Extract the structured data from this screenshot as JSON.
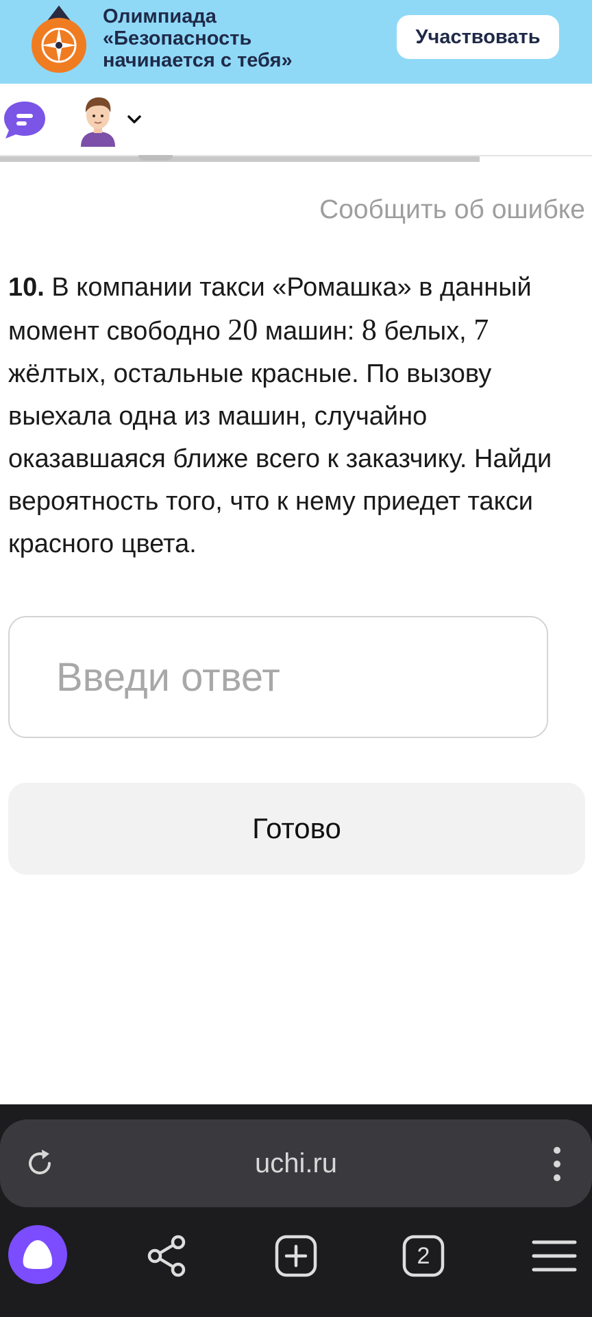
{
  "banner": {
    "title": "Олимпиада\n«Безопасность\nначинается с тебя»",
    "button_label": "Участвовать",
    "logo_icon": "olympiad-compass-logo",
    "background": "#8fd9f7",
    "accent": "#f07c22"
  },
  "toolbar": {
    "chat_icon": "chat-bubble-icon",
    "avatar": "boy-avatar",
    "chevron_icon": "chevron-down-icon"
  },
  "task": {
    "report_link": "Сообщить об ошибке",
    "number": "10.",
    "text_1": " В компании такси «Ромашка» в данный момент свободно ",
    "total_cars": "20",
    "text_2": " машин: ",
    "white_cars": "8",
    "text_3": " белых, ",
    "yellow_cars": "7",
    "text_4": " жёлтых, остальные красные. По вызову выехала одна из машин, случайно оказавшаяся ближе всего к заказчику. Найди вероятность того, что к нему приедет такси красного цвета."
  },
  "answer": {
    "placeholder": "Введи ответ",
    "value": ""
  },
  "submit": {
    "label": "Готово"
  },
  "browser": {
    "url": "uchi.ru",
    "tab_count": "2",
    "reload_icon": "reload-icon",
    "menu_icon": "kebab-menu-icon",
    "nav_icons": [
      "alice-assistant-icon",
      "share-icon",
      "new-tab-plus-icon",
      "tabs-counter-icon",
      "hamburger-menu-icon"
    ]
  }
}
